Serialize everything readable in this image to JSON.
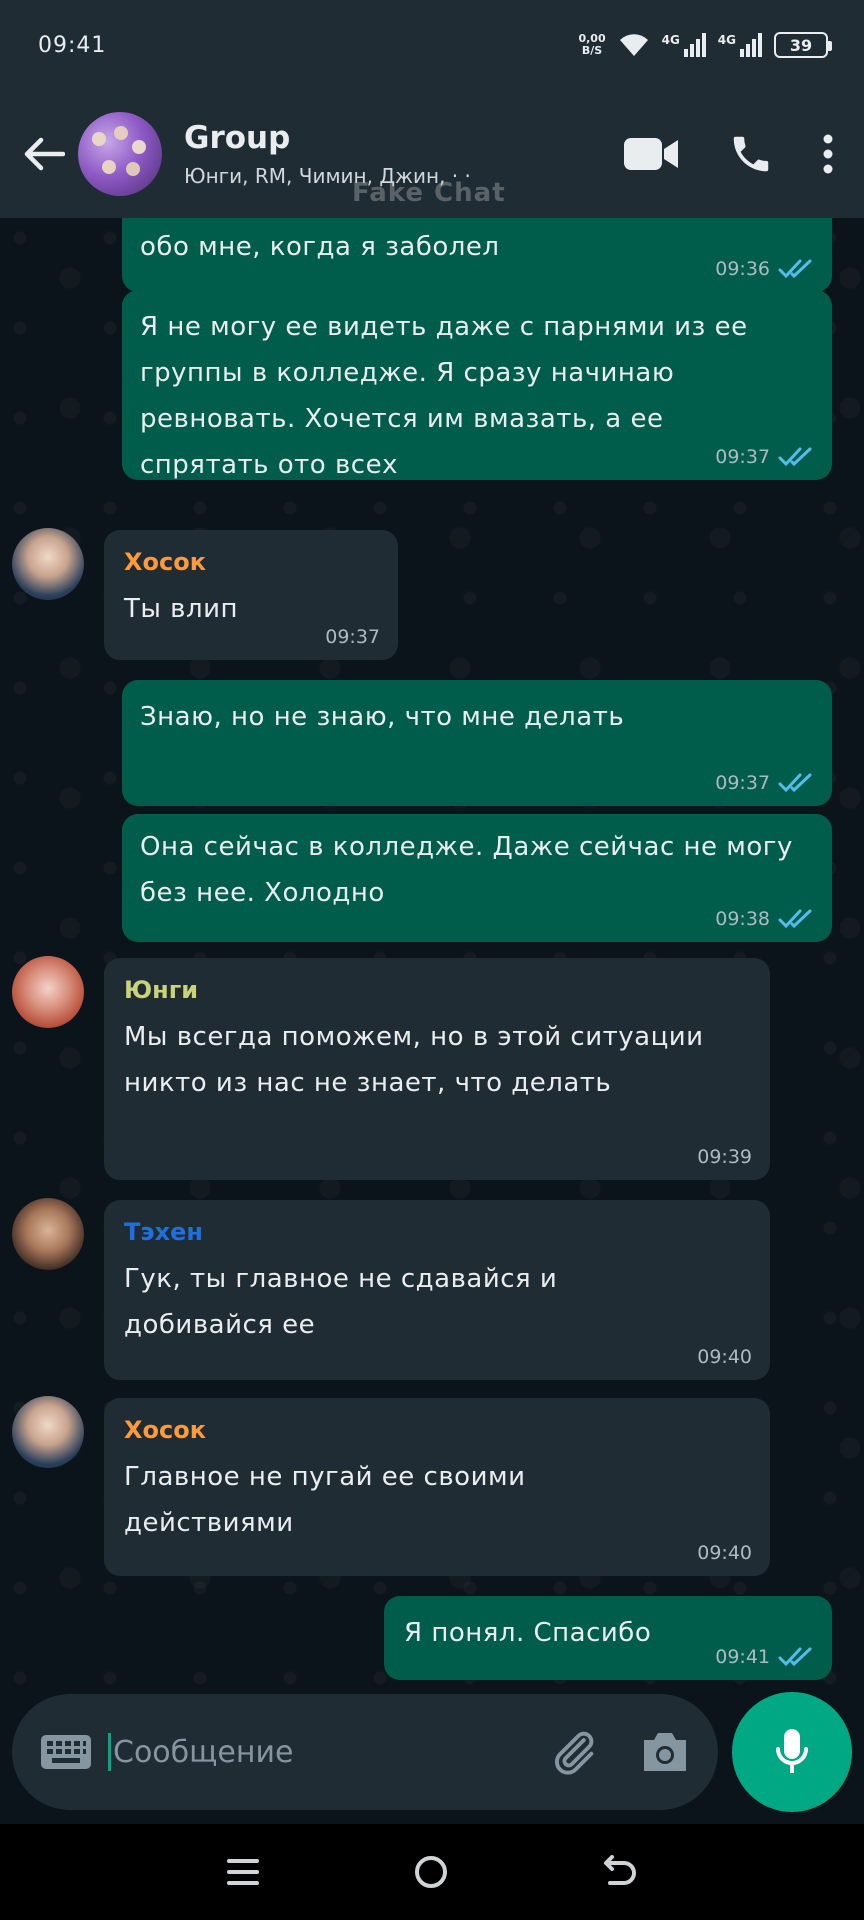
{
  "status_bar": {
    "time": "09:41",
    "net_speed_value": "0,00",
    "net_speed_unit": "B/S",
    "signal1_label": "4G",
    "signal2_label": "4G",
    "battery": "39"
  },
  "header": {
    "title": "Group",
    "members": "Юнги, RM, Чимин, Джин, · ·",
    "watermark": "Fake Chat"
  },
  "messages": [
    {
      "dir": "out",
      "text": "обо мне, когда я заболел",
      "time": "09:36",
      "ticks": "read"
    },
    {
      "dir": "out",
      "text": "Я не могу ее видеть даже с парнями из ее группы в колледже. Я сразу начинаю ревновать. Хочется им вмазать, а ее спрятать ото всех",
      "time": "09:37",
      "ticks": "read"
    },
    {
      "dir": "in",
      "sender": "Хосок",
      "sender_color": "#fc9a3c",
      "text": "Ты влип",
      "time": "09:37"
    },
    {
      "dir": "out",
      "text": "Знаю, но не знаю, что мне делать",
      "time": "09:37",
      "ticks": "read"
    },
    {
      "dir": "out",
      "text": "Она сейчас в колледже. Даже сейчас не могу без нее. Холодно",
      "time": "09:38",
      "ticks": "read"
    },
    {
      "dir": "in",
      "sender": "Юнги",
      "sender_color": "#c9d47a",
      "text": "Мы всегда поможем, но в этой ситуации никто из нас не знает, что делать",
      "time": "09:39"
    },
    {
      "dir": "in",
      "sender": "Тэхен",
      "sender_color": "#1f6fe0",
      "text": "Гук, ты главное не сдавайся и добивайся ее",
      "time": "09:40"
    },
    {
      "dir": "in",
      "sender": "Хосок",
      "sender_color": "#fc9a3c",
      "text": "Главное не пугай ее своими действиями",
      "time": "09:40"
    },
    {
      "dir": "out",
      "text": "Я понял. Спасибо",
      "time": "09:41",
      "ticks": "read"
    }
  ],
  "input": {
    "placeholder": "Сообщение"
  },
  "colors": {
    "outgoing_bubble": "#005c4b",
    "incoming_bubble": "#202c33",
    "accent": "#00a884",
    "read_tick": "#53bdeb"
  },
  "icons": [
    "back-arrow-icon",
    "video-call-icon",
    "phone-icon",
    "more-vert-icon",
    "keyboard-icon",
    "attach-icon",
    "camera-icon",
    "mic-icon",
    "menu-icon",
    "home-icon",
    "back-nav-icon"
  ]
}
